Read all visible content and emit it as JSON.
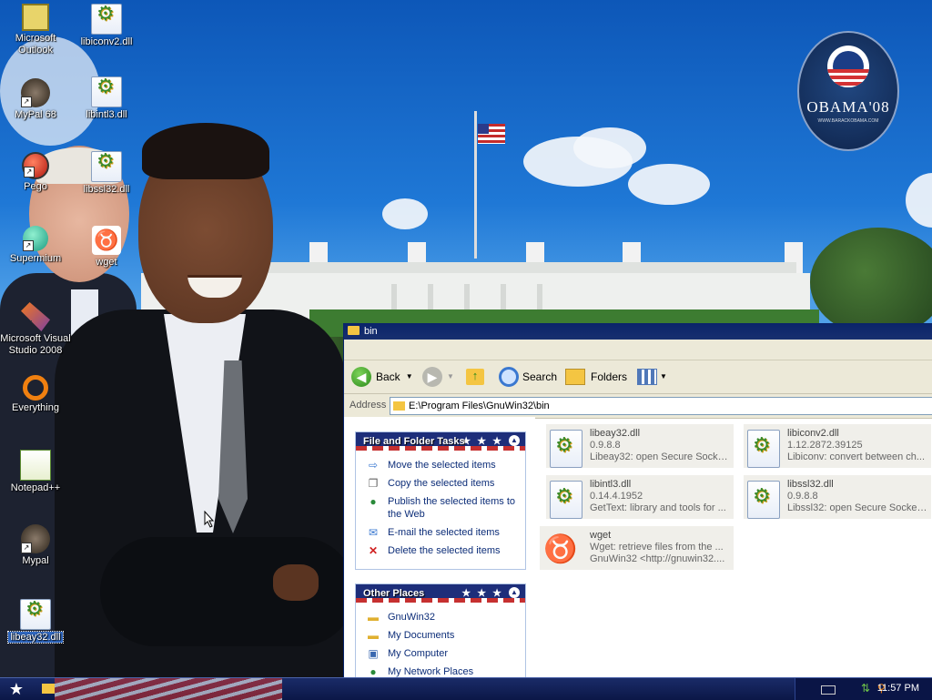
{
  "desktop_icons": [
    {
      "label": "Microsoft Outlook"
    },
    {
      "label": "MyPal 68"
    },
    {
      "label": "Pego"
    },
    {
      "label": "Supermium"
    },
    {
      "label": "Microsoft Visual Studio 2008"
    },
    {
      "label": "Everything"
    },
    {
      "label": "Notepad++"
    },
    {
      "label": "Mypal"
    },
    {
      "label": "libeay32.dll"
    },
    {
      "label": "libiconv2.dll"
    },
    {
      "label": "libintl3.dll"
    },
    {
      "label": "libssl32.dll"
    },
    {
      "label": "wget"
    }
  ],
  "wallpaper": {
    "logo_text": "OBAMA'08",
    "logo_subtext": "WWW.BARACKOBAMA.COM"
  },
  "window": {
    "title": "bin",
    "toolbar": {
      "back": "Back",
      "search": "Search",
      "folders": "Folders"
    },
    "address": {
      "label": "Address",
      "value": "E:\\Program Files\\GnuWin32\\bin"
    },
    "file_tasks": {
      "title": "File and Folder Tasks",
      "items": [
        "Move the selected items",
        "Copy the selected items",
        "Publish the selected items to the Web",
        "E-mail the selected items",
        "Delete the selected items"
      ]
    },
    "other_places": {
      "title": "Other Places",
      "items": [
        "GnuWin32",
        "My Documents",
        "My Computer",
        "My Network Places"
      ]
    },
    "files": [
      {
        "name": "libeay32.dll",
        "version": "0.9.8.8",
        "desc": "Libeay32: open Secure Socket..."
      },
      {
        "name": "libiconv2.dll",
        "version": "1.12.2872.39125",
        "desc": "Libiconv: convert between ch..."
      },
      {
        "name": "libintl3.dll",
        "version": "0.14.4.1952",
        "desc": "GetText: library and tools for ..."
      },
      {
        "name": "libssl32.dll",
        "version": "0.9.8.8",
        "desc": "Libssl32: open Secure Socket ..."
      },
      {
        "name": "wget",
        "version": "Wget: retrieve files from the ...",
        "desc": "GnuWin32 <http://gnuwin32...."
      }
    ]
  },
  "taskbar": {
    "clock": "11:57 PM"
  }
}
